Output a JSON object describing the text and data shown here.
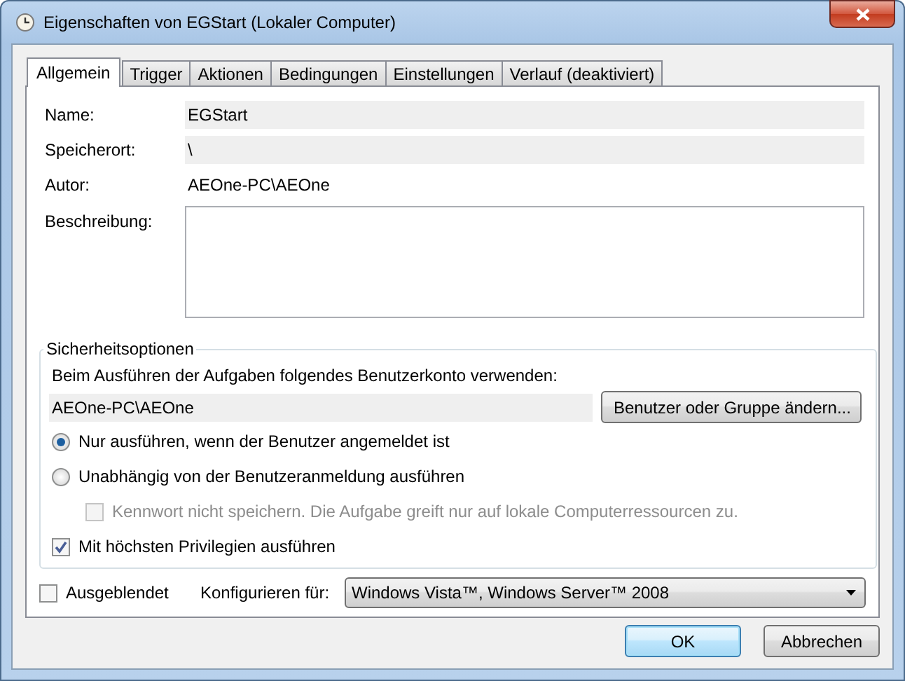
{
  "window": {
    "title": "Eigenschaften von EGStart (Lokaler Computer)"
  },
  "tabs": [
    {
      "label": "Allgemein",
      "selected": true
    },
    {
      "label": "Trigger",
      "selected": false
    },
    {
      "label": "Aktionen",
      "selected": false
    },
    {
      "label": "Bedingungen",
      "selected": false
    },
    {
      "label": "Einstellungen",
      "selected": false
    },
    {
      "label": "Verlauf (deaktiviert)",
      "selected": false
    }
  ],
  "fields": [
    {
      "label": "Name:",
      "value": "EGStart",
      "kind": "readonly"
    },
    {
      "label": "Speicherort:",
      "value": "\\",
      "kind": "readonly"
    },
    {
      "label": "Autor:",
      "value": "AEOne-PC\\AEOne",
      "kind": "plain"
    },
    {
      "label": "Beschreibung:",
      "kind": "textarea"
    }
  ],
  "security": {
    "title": "Sicherheitsoptionen",
    "account_label": "Beim Ausführen der Aufgaben folgendes Benutzerkonto verwenden:",
    "account": "AEOne-PC\\AEOne",
    "change_button": "Benutzer oder Gruppe ändern...",
    "options": [
      {
        "kind": "radio",
        "label": "Nur ausführen, wenn der Benutzer angemeldet ist",
        "selected": true,
        "disabled": false
      },
      {
        "kind": "radio",
        "label": "Unabhängig von der Benutzeranmeldung ausführen",
        "selected": false,
        "disabled": false,
        "children": [
          {
            "kind": "checkbox",
            "label": "Kennwort nicht speichern. Die Aufgabe greift nur auf lokale Computerressourcen zu.",
            "checked": false,
            "disabled": true
          }
        ]
      },
      {
        "kind": "checkbox",
        "label": "Mit höchsten Privilegien ausführen",
        "checked": true,
        "disabled": false
      }
    ]
  },
  "hidden": {
    "label": "Ausgeblendet",
    "checked": false
  },
  "configure": {
    "label": "Konfigurieren für:",
    "value": "Windows Vista™, Windows Server™ 2008"
  },
  "buttons": [
    {
      "label": "OK",
      "default": true
    },
    {
      "label": "Abbrechen",
      "default": false
    }
  ]
}
